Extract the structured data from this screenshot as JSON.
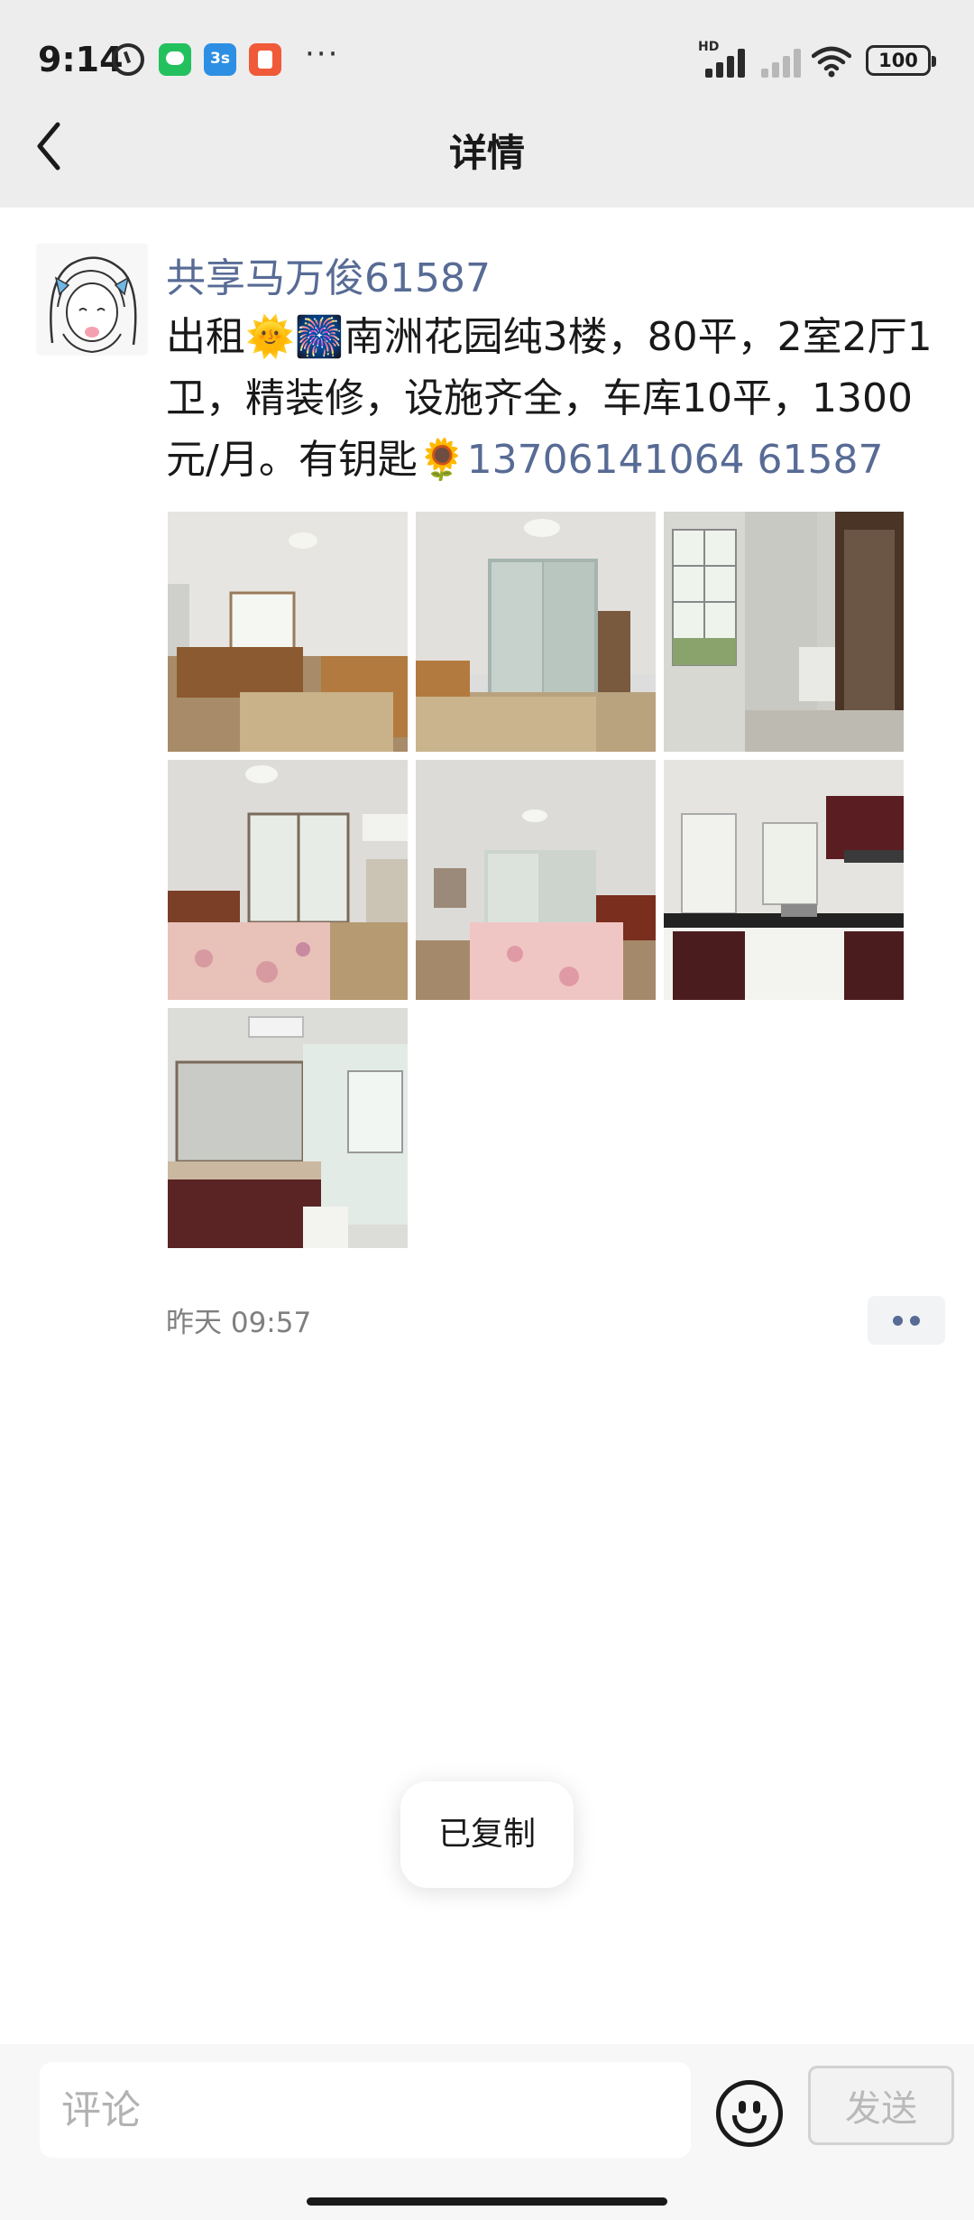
{
  "status_bar": {
    "time": "9:14",
    "app_icons": [
      "alarm-icon",
      "wechat-icon",
      "3s-app-icon",
      "red-app-icon"
    ],
    "app3s_text": "3s",
    "more": "···",
    "hd": "HD",
    "battery": "100"
  },
  "nav": {
    "title": "详情",
    "back_icon": "chevron-left-icon"
  },
  "post": {
    "username": "共享马万俊61587",
    "text_parts": {
      "p1": "出租",
      "e1": "🌞",
      "e2": "🎆",
      "p2": "南洲花园纯3楼，80平，2室2厅1卫，精装修，设施齐全，车库10平，1300元/月。有钥匙",
      "e3": "🌻",
      "link": "13706141064 61587"
    },
    "photos": [
      {
        "name": "bedroom-window"
      },
      {
        "name": "bedroom-wardrobe"
      },
      {
        "name": "balcony"
      },
      {
        "name": "bedroom-balcony-door"
      },
      {
        "name": "bedroom-pink-bed"
      },
      {
        "name": "kitchen"
      },
      {
        "name": "bathroom"
      }
    ],
    "timestamp": "昨天 09:57"
  },
  "toast": {
    "text": "已复制"
  },
  "comment_bar": {
    "placeholder": "评论",
    "send_label": "发送",
    "emoji_icon": "smiley-icon"
  },
  "colors": {
    "link": "#576b95",
    "top_bar": "#ededed",
    "bottom_bar": "#f7f7f7"
  }
}
